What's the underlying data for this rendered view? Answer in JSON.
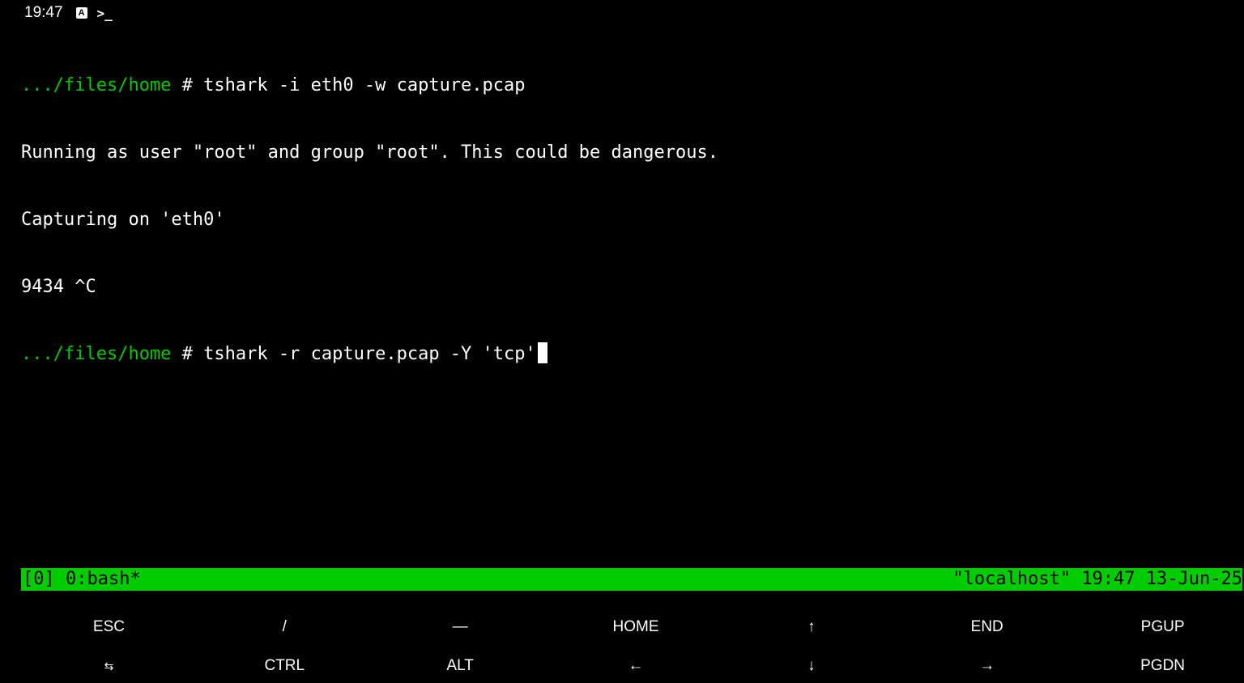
{
  "status_bar": {
    "time": "19:47",
    "icons": [
      "notification-a-icon",
      "terminal-icon"
    ]
  },
  "terminal": {
    "lines": [
      {
        "prompt": ".../files/home",
        "text": " # tshark -i eth0 -w capture.pcap"
      },
      {
        "prompt": "",
        "text": "Running as user \"root\" and group \"root\". This could be dangerous."
      },
      {
        "prompt": "",
        "text": "Capturing on 'eth0'"
      },
      {
        "prompt": "",
        "text": "9434 ^C"
      },
      {
        "prompt": ".../files/home",
        "text": " # tshark -r capture.pcap -Y 'tcp'"
      }
    ]
  },
  "tmux": {
    "left": "[0] 0:bash*",
    "right": "\"localhost\" 19:47 13-Jun-25"
  },
  "extra_keys": {
    "row1": [
      "ESC",
      "/",
      "—",
      "HOME",
      "↑",
      "END",
      "PGUP"
    ],
    "row2": [
      "⇆",
      "CTRL",
      "ALT",
      "←",
      "↓",
      "→",
      "PGDN"
    ]
  },
  "colors": {
    "background": "#000000",
    "prompt": "#00cc00",
    "tmux_bar": "#00cc00",
    "text": "#ffffff"
  }
}
